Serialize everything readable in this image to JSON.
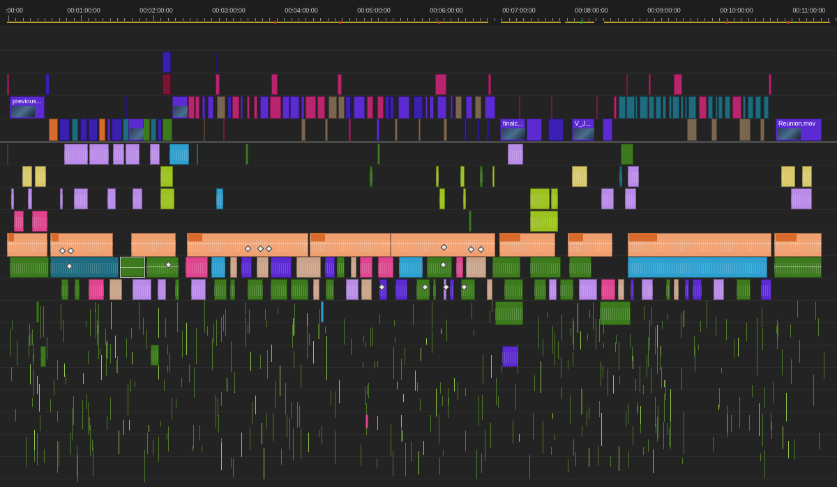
{
  "app": "Premiere Pro timeline",
  "ruler": {
    "labels": [
      ":00:00",
      "00:01:00:00",
      "00:02:00:00",
      "00:03:00:00",
      "00:04:00:00",
      "00:05:00:00",
      "00:06:00:00",
      "00:07:00:00",
      "00:08:00:00",
      "00:09:00:00",
      "00:10:00:00",
      "00:11:00:00"
    ],
    "workbar_color": "#b9a22d"
  },
  "clip_names": {
    "v3_previous": "previous...",
    "v1_finalc": "finalc...",
    "v1_vj": "V_J...",
    "v1_reunion": "Reunion.mov"
  },
  "colors": {
    "purple": "#5b2bd1",
    "violet": "#3a1fb0",
    "magenta": "#b8246e",
    "darkred": "#7a1433",
    "tan": "#7a6650",
    "teal": "#1e6b80",
    "green": "#3d7a1e",
    "lime": "#9bc21f",
    "lavender": "#b98ae8",
    "orange": "#d86a2c",
    "peach": "#f0a070",
    "pink": "#e0448f",
    "cyan": "#2ea0d0",
    "beige": "#c9a48a",
    "yellow": "#d8c86a"
  }
}
